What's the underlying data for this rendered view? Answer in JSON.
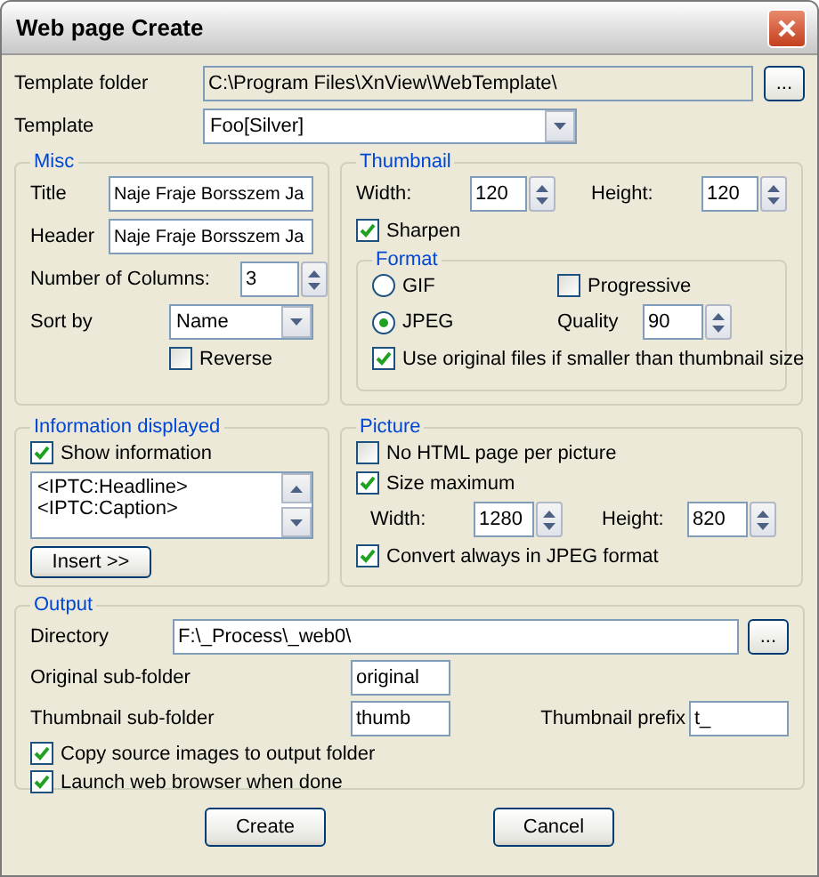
{
  "window": {
    "title": "Web page Create"
  },
  "template_folder": {
    "label": "Template folder",
    "value": "C:\\Program Files\\XnView\\WebTemplate\\",
    "browse": "..."
  },
  "template": {
    "label": "Template",
    "value": "Foo[Silver]"
  },
  "misc": {
    "title": "Misc",
    "fields": [
      {
        "label": "Title",
        "value": "Naje Fraje Borsszem Ja"
      },
      {
        "label": "Header",
        "value": "Naje Fraje Borsszem Ja"
      }
    ],
    "columns": {
      "label": "Number of Columns:",
      "value": "3"
    },
    "sort": {
      "label": "Sort by",
      "value": "Name"
    },
    "reverse": {
      "label": "Reverse",
      "checked": false
    }
  },
  "thumbnail": {
    "title": "Thumbnail",
    "width": {
      "label": "Width:",
      "value": "120"
    },
    "height": {
      "label": "Height:",
      "value": "120"
    },
    "sharpen": {
      "label": "Sharpen",
      "checked": true
    },
    "format": {
      "title": "Format",
      "options": [
        {
          "label": "GIF",
          "selected": false
        },
        {
          "label": "JPEG",
          "selected": true
        }
      ],
      "progressive": {
        "label": "Progressive",
        "checked": false
      },
      "quality": {
        "label": "Quality",
        "value": "90"
      },
      "use_original": {
        "label": "Use original files if smaller than thumbnail size",
        "checked": true
      }
    }
  },
  "information": {
    "title": "Information displayed",
    "show": {
      "label": "Show information",
      "checked": true
    },
    "lines": [
      "<IPTC:Headline>",
      "<IPTC:Caption>"
    ],
    "insert": "Insert >>"
  },
  "picture": {
    "title": "Picture",
    "no_html": {
      "label": "No HTML page per picture",
      "checked": false
    },
    "size_max": {
      "label": "Size maximum",
      "checked": true
    },
    "width": {
      "label": "Width:",
      "value": "1280"
    },
    "height": {
      "label": "Height:",
      "value": "820"
    },
    "convert": {
      "label": "Convert always in JPEG format",
      "checked": true
    }
  },
  "output": {
    "title": "Output",
    "directory": {
      "label": "Directory",
      "value": "F:\\_Process\\_web0\\",
      "browse": "..."
    },
    "original_sub": {
      "label": "Original sub-folder",
      "value": "original"
    },
    "thumb_sub": {
      "label": "Thumbnail sub-folder",
      "value": "thumb"
    },
    "prefix": {
      "label": "Thumbnail prefix",
      "value": "t_"
    },
    "options": [
      {
        "label": "Copy source images to output folder",
        "checked": true
      },
      {
        "label": "Launch web browser when done",
        "checked": true
      }
    ]
  },
  "buttons": [
    "Create",
    "Cancel"
  ]
}
